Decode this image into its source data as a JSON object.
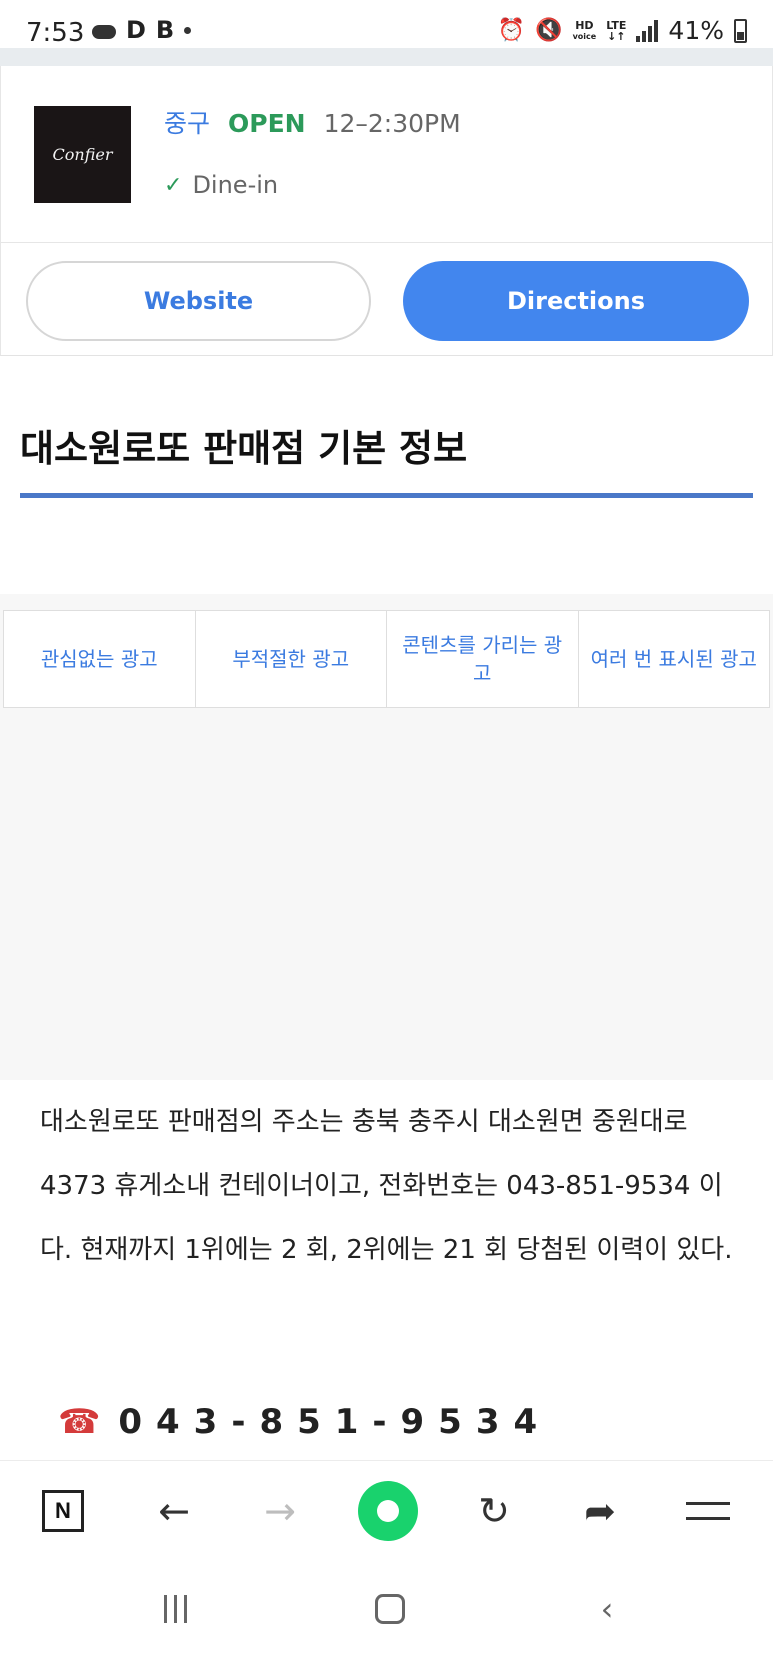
{
  "status_bar": {
    "time": "7:53",
    "left_icons": [
      "cloud-icon",
      "d-app-icon",
      "b-app-icon",
      "dot-icon"
    ],
    "left_glyph_d": "D",
    "left_glyph_b": "B",
    "right_icons": [
      "alarm-icon",
      "mute-icon",
      "hd-voice-icon",
      "lte-icon",
      "signal-icon",
      "battery-icon"
    ],
    "hd_top": "HD",
    "hd_bottom": "voice",
    "lte_label": "LTE",
    "battery": "41%"
  },
  "business": {
    "logo_text": "Confier",
    "category": "중구",
    "status": "OPEN",
    "hours": "12–2:30PM",
    "service": "Dine-in",
    "website_label": "Website",
    "directions_label": "Directions"
  },
  "section": {
    "title": "대소원로또 판매점 기본 정보"
  },
  "ad_feedback": {
    "options": [
      "관심없는 광고",
      "부적절한 광고",
      "콘텐츠를 가리는 광고",
      "여러 번 표시된 광고"
    ]
  },
  "description": "대소원로또 판매점의 주소는 충북 충주시 대소원면 중원대로 4373 휴게소내 컨테이너이고, 전화번호는 043-851-9534 이다. 현재까지 1위에는 2 회, 2위에는 21 회 당첨된 이력이 있다.",
  "phone": {
    "number": "043-851-9534"
  },
  "toolbar": {
    "items": [
      "naver-home-icon",
      "back-arrow-icon",
      "forward-arrow-icon",
      "green-dot-icon",
      "refresh-icon",
      "share-icon",
      "menu-icon"
    ],
    "n_label": "N"
  },
  "nav": {
    "items": [
      "recents-icon",
      "home-icon",
      "back-icon"
    ]
  },
  "colors": {
    "accent_blue": "#4286ee",
    "link_blue": "#3b7be0",
    "open_green": "#2c9a5a",
    "rule_blue": "#4a78c8",
    "brand_green": "#19d26d"
  }
}
